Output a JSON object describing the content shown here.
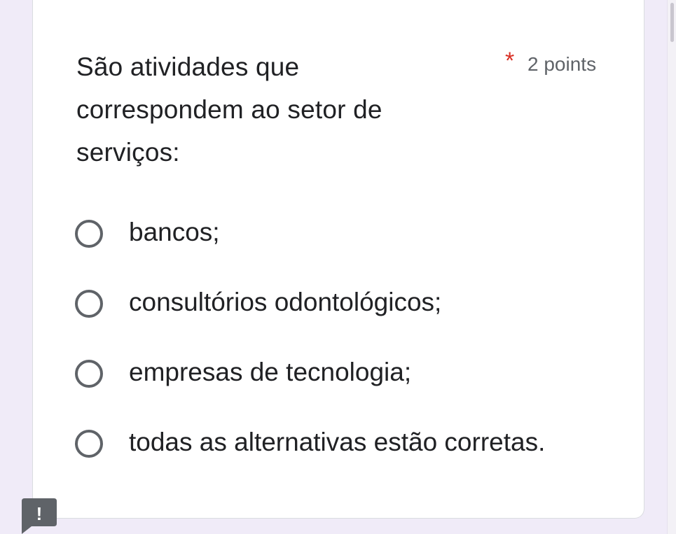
{
  "question": {
    "title": "São atividades que correspondem ao setor de serviços:",
    "required_mark": "*",
    "points": "2 points"
  },
  "options": [
    {
      "label": "bancos;"
    },
    {
      "label": "consultórios odontológicos;"
    },
    {
      "label": "empresas de tecnologia;"
    },
    {
      "label": "todas as alternativas estão corretas."
    }
  ],
  "alert_badge": {
    "text": "!",
    "icon": "alert-icon"
  },
  "colors": {
    "background": "#f0ebf8",
    "card": "#ffffff",
    "required": "#d93025",
    "text": "#202124",
    "secondary_text": "#5f6368",
    "badge": "#5f6368"
  }
}
